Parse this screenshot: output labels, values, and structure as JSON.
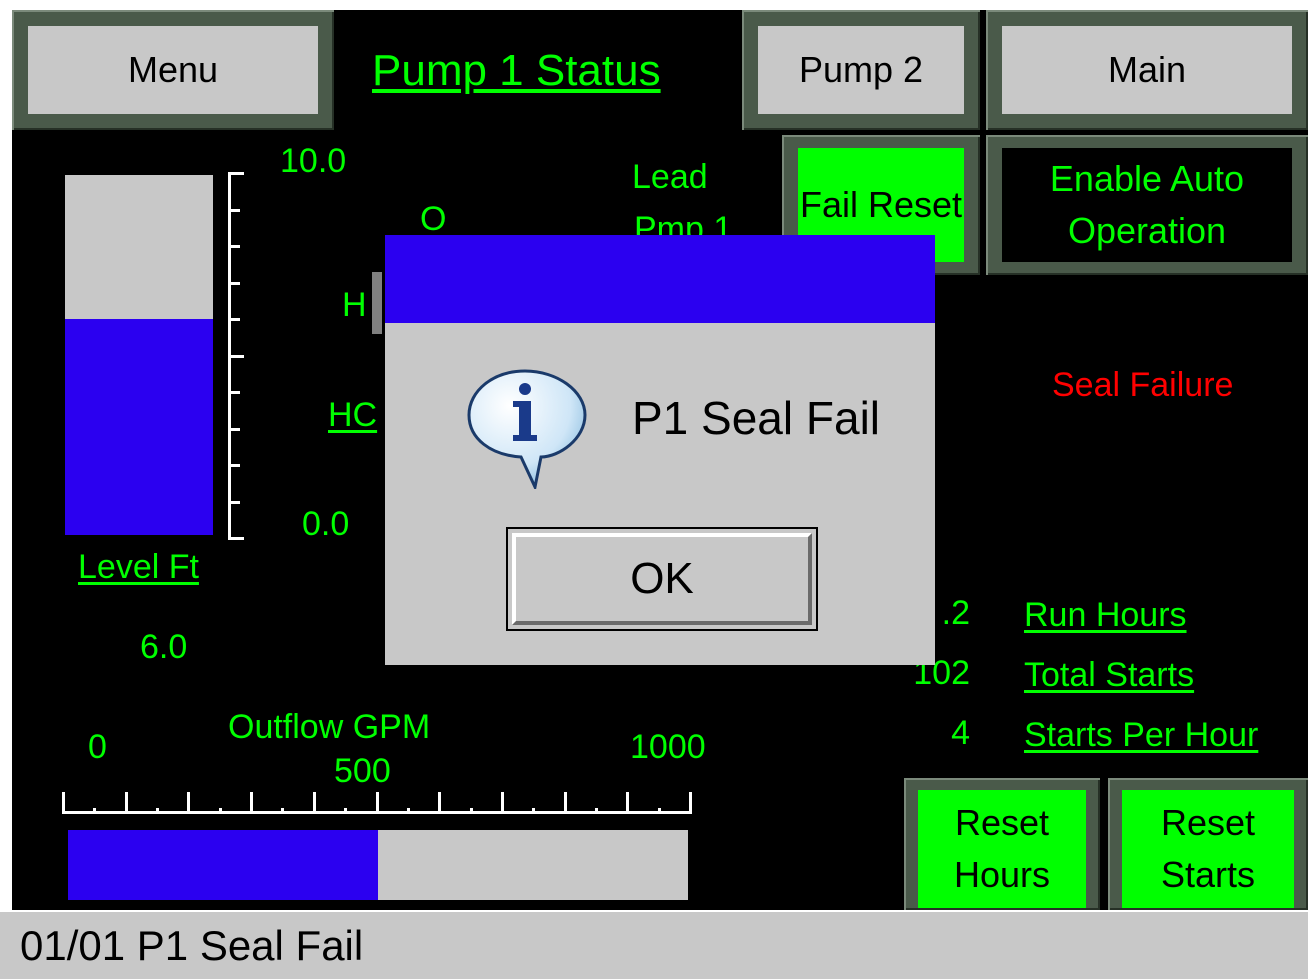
{
  "header": {
    "menu_label": "Menu",
    "title": "Pump 1 Status",
    "pump2_label": "Pump 2",
    "main_label": "Main"
  },
  "controls": {
    "fail_reset_label": "Fail Reset",
    "enable_auto_label": "Enable Auto Operation",
    "reset_hours_label": "Reset Hours",
    "reset_starts_label": "Reset Starts"
  },
  "level": {
    "scale_max": "10.0",
    "scale_min": "0.0",
    "label": "Level Ft",
    "value": "6.0",
    "fill_fraction": 0.6
  },
  "partial_labels": {
    "o": "O",
    "h": "H",
    "hc": "HC",
    "lead": "Lead",
    "pmp": "Pmp 1"
  },
  "alarm": {
    "text": "Seal Failure",
    "color": "#ff0000"
  },
  "stats": [
    {
      "value": ".2",
      "label": "Run Hours"
    },
    {
      "value": "102",
      "label": "Total Starts"
    },
    {
      "value": "4",
      "label": "Starts Per Hour"
    }
  ],
  "outflow": {
    "label": "Outflow GPM",
    "min": "0",
    "mid": "500",
    "max": "1000",
    "fill_fraction": 0.5
  },
  "dialog": {
    "message": "P1 Seal Fail",
    "ok_label": "OK",
    "icon": "info-icon"
  },
  "statusbar": {
    "text": "01/01 P1 Seal Fail"
  },
  "colors": {
    "screen_bg": "#000000",
    "label_green": "#00ff00",
    "button_grey": "#c8c8c8",
    "bar_blue": "#2b00f0",
    "alarm_red": "#ff0000"
  }
}
